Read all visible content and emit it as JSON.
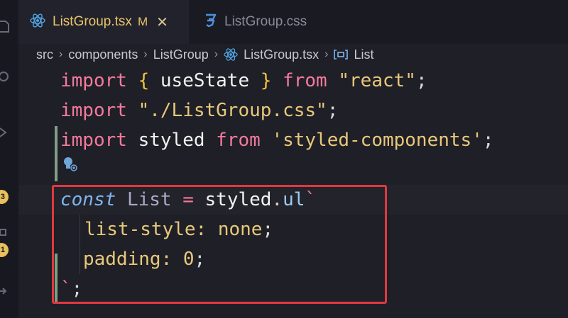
{
  "tabs": [
    {
      "label": "ListGroup.tsx",
      "status": "M",
      "close": "✕",
      "icon": "react-icon"
    },
    {
      "label": "ListGroup.css",
      "icon": "css-icon"
    }
  ],
  "breadcrumb": {
    "items": [
      "src",
      "components",
      "ListGroup",
      "ListGroup.tsx",
      "List"
    ],
    "separator": "›"
  },
  "activity": {
    "badges": [
      "3",
      "1"
    ]
  },
  "code": {
    "line1": {
      "kw1": "import",
      "b1": "{",
      "id": "useState",
      "b2": "}",
      "kw2": "from",
      "str": "\"react\"",
      "end": ";"
    },
    "line2": {
      "kw1": "import",
      "str": "\"./ListGroup.css\"",
      "end": ";"
    },
    "line3": {
      "kw1": "import",
      "id": "styled",
      "kw2": "from",
      "str": "'styled-components'",
      "end": ";"
    },
    "line5": {
      "kw": "const",
      "name": "List",
      "op": "=",
      "obj": "styled",
      "dot": ".",
      "method": "ul",
      "tick": "`"
    },
    "line6": {
      "prop": "list-style:",
      "val": "none",
      "end": ";"
    },
    "line7": {
      "prop": "padding:",
      "val": "0",
      "end": ";"
    },
    "line8": {
      "tick": "`",
      "end": ";"
    }
  },
  "colors": {
    "accent_tab": "#e9c46a",
    "keyword": "#f47a9c",
    "highlight_box": "#e0393e",
    "react": "#4fa3e0"
  }
}
